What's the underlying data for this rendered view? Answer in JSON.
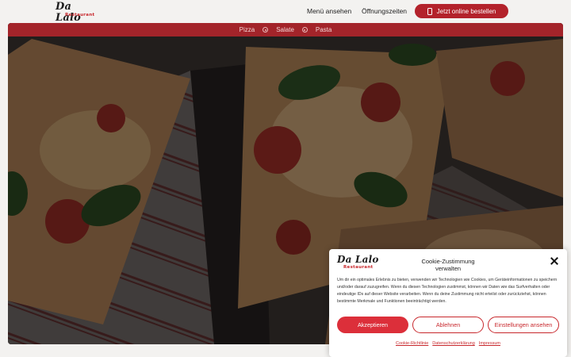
{
  "brand": {
    "name": "Da Lalo",
    "subtitle": "Restaurant",
    "accent_color": "#b3222b"
  },
  "header": {
    "nav": {
      "menu_label": "Menü ansehen",
      "hours_label": "Öffnungszeiten"
    },
    "order_button": {
      "label": "Jetzt online bestellen",
      "icon": "phone-icon"
    }
  },
  "categories": {
    "items": [
      "Pizza",
      "Salate",
      "Pasta"
    ]
  },
  "hero": {
    "image": "pizza-slices-photo"
  },
  "cookie_banner": {
    "title": "Cookie-Zustimmung verwalten",
    "text": "Um dir ein optimales Erlebnis zu bieten, verwenden wir Technologien wie Cookies, um Geräteinformationen zu speichern und/oder darauf zuzugreifen. Wenn du diesen Technologien zustimmst, können wir Daten wie das Surfverhalten oder eindeutige IDs auf dieser Website verarbeiten. Wenn du deine Zustimmung nicht erteilst oder zurückziehst, können bestimmte Merkmale und Funktionen beeinträchtigt werden.",
    "accept_label": "Akzeptieren",
    "deny_label": "Ablehnen",
    "settings_label": "Einstellungen ansehen",
    "links": {
      "cookie_policy": "Cookie-Richtlinie",
      "privacy": "Datenschutzerklärung",
      "imprint": "Impressum"
    }
  }
}
